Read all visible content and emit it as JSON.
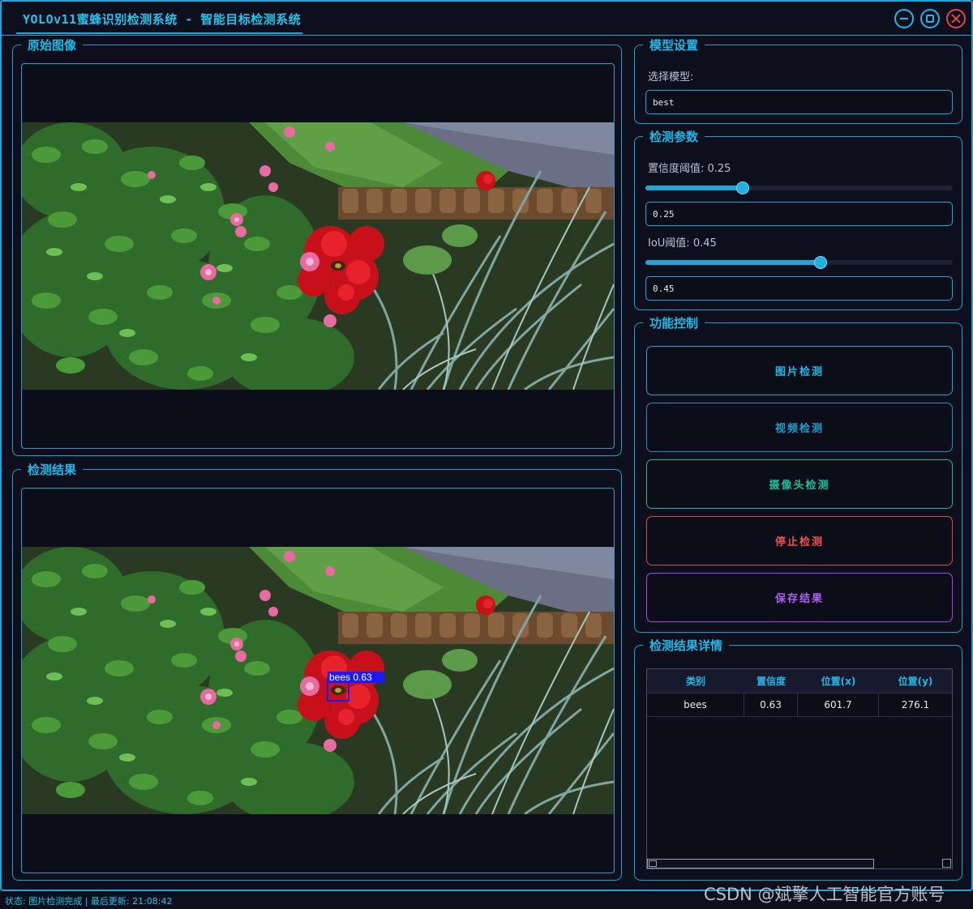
{
  "window": {
    "title": "YOLOv11蜜蜂识别检测系统 - 智能目标检测系统"
  },
  "panels": {
    "original_image": {
      "title": "原始图像"
    },
    "result_image": {
      "title": "检测结果"
    }
  },
  "detection_overlay": {
    "label": "bees 0.63",
    "color": "#1a1aff"
  },
  "model_settings": {
    "title": "模型设置",
    "select_label": "选择模型:",
    "selected_model": "best"
  },
  "params": {
    "title": "检测参数",
    "confidence_label": "置信度阈值: 0.25",
    "confidence_value": "0.25",
    "confidence_fraction": 0.25,
    "iou_label": "IoU阈值: 0.45",
    "iou_value": "0.45",
    "iou_fraction": 0.45
  },
  "controls": {
    "title": "功能控制",
    "image_detect": "图片检测",
    "video_detect": "视频检测",
    "camera_detect": "摄像头检测",
    "stop_detect": "停止检测",
    "save_results": "保存结果"
  },
  "details": {
    "title": "检测结果详情",
    "columns": [
      "类别",
      "置信度",
      "位置(x)",
      "位置(y)"
    ],
    "rows": [
      [
        "bees",
        "0.63",
        "601.7",
        "276.1"
      ]
    ]
  },
  "status": {
    "text": "状态: 图片检测完成 | 最后更新: 21:08:42"
  },
  "watermark": "CSDN @斌擎人工智能官方账号",
  "colors": {
    "accent": "#1fa5d8",
    "video_button": "#1f8fc0",
    "camera_button": "#18b89a",
    "stop_button": "#e04848",
    "save_button": "#a24ee0"
  }
}
